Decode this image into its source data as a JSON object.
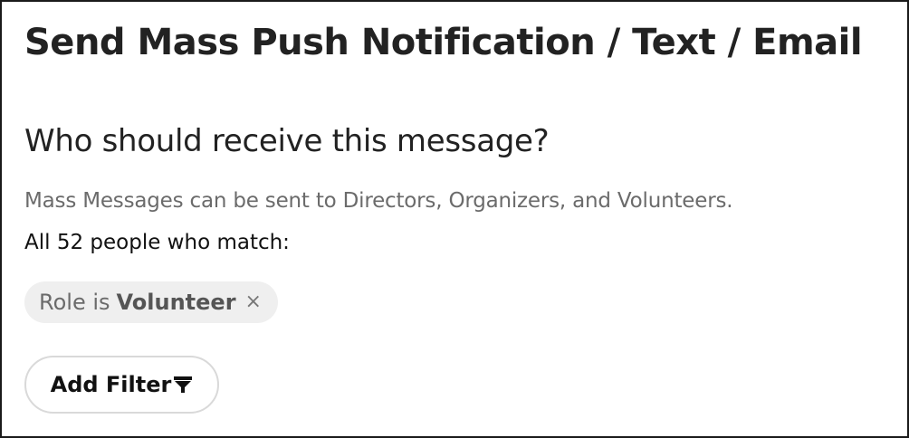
{
  "page": {
    "title": "Send Mass Push Notification / Text / Email"
  },
  "recipients": {
    "heading": "Who should receive this message?",
    "helper_text": "Mass Messages can be sent to Directors, Organizers, and Volunteers.",
    "match_summary": "All 52 people who match:",
    "filters": [
      {
        "field": "Role is",
        "value": "Volunteer",
        "remove_symbol": "×"
      }
    ],
    "add_filter_label": "Add Filter",
    "add_filter_icon": "funnel-icon"
  },
  "colors": {
    "title_text": "#222222",
    "helper_text": "#6b6b6b",
    "chip_background": "#efefef",
    "button_border": "#d9d9d9",
    "frame_border": "#1a1a1a"
  }
}
